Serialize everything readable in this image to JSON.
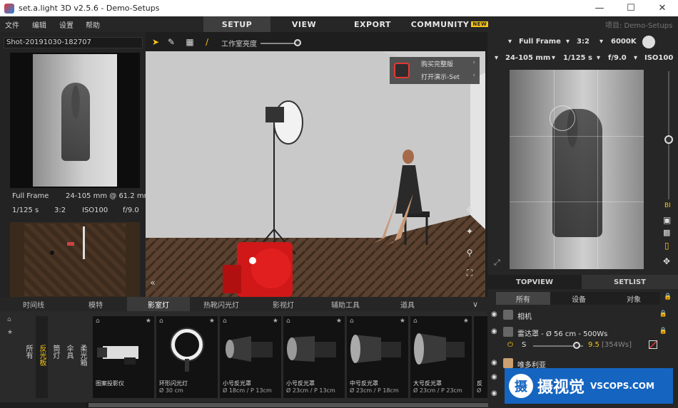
{
  "window": {
    "title": "set.a.light 3D v2.5.6 - Demo-Setups"
  },
  "menu": {
    "file": "文件",
    "edit": "编辑",
    "settings": "设置",
    "help": "帮助",
    "nav": [
      "SETUP",
      "VIEW",
      "EXPORT",
      "COMMUNITY"
    ],
    "new_badge": "NEW",
    "project_label": "项目: Demo-Setups"
  },
  "left": {
    "shot_name": "Shot-20191030-182707",
    "format": "Full Frame",
    "lens": "24-105 mm @ 61.2 mm",
    "shutter": "1/125 s",
    "ratio": "3:2",
    "iso": "ISO100",
    "aperture": "f/9.0"
  },
  "toolbar": {
    "studio_brightness": "工作室亮度"
  },
  "promo": {
    "buy": "购买完整版",
    "open_demo": "打开演示-Set"
  },
  "camera_bar": {
    "sensor": "Full Frame",
    "ratio": "3:2",
    "kelvin": "6000K",
    "lens": "24-105 mm",
    "shutter": "1/125 s",
    "aperture": "f/9.0",
    "iso": "ISO100"
  },
  "right_tabs": {
    "topview": "TOPVIEW",
    "setlist": "SETLIST"
  },
  "filter": {
    "all": "所有",
    "devices": "设备",
    "objects": "对象"
  },
  "setlist": [
    {
      "name": "相机"
    },
    {
      "name": "雷达罩 - Ø 56 cm - 500Ws",
      "power_label": "S",
      "power_value": "9.5",
      "power_ws": "[354Ws]"
    },
    {
      "name": "唯多利亚"
    }
  ],
  "categories": [
    "时间线",
    "模特",
    "影室灯",
    "热靴闪光灯",
    "影视灯",
    "辅助工具",
    "道具"
  ],
  "vertical_categories": [
    "所有",
    "反光板",
    "筒灯",
    "伞具",
    "柔光箱"
  ],
  "library": [
    {
      "name": "图案投影仪",
      "spec": ""
    },
    {
      "name": "环形闪光灯",
      "spec": "Ø 30 cm"
    },
    {
      "name": "小号反光罩",
      "spec": "Ø 18cm / P 13cm"
    },
    {
      "name": "小号反光罩",
      "spec": "Ø 23cm / P 13cm"
    },
    {
      "name": "中号反光罩",
      "spec": "Ø 23cm / P 18cm"
    },
    {
      "name": "大号反光罩",
      "spec": "Ø 23cm / P 23cm"
    },
    {
      "name": "反",
      "spec": "Ø"
    }
  ],
  "watermark": {
    "text": "摄视觉",
    "url": "VSCOPS.COM"
  },
  "colors": {
    "accent": "#f5c518",
    "brand_blue": "#1565c0",
    "flash_red": "#e53935"
  }
}
